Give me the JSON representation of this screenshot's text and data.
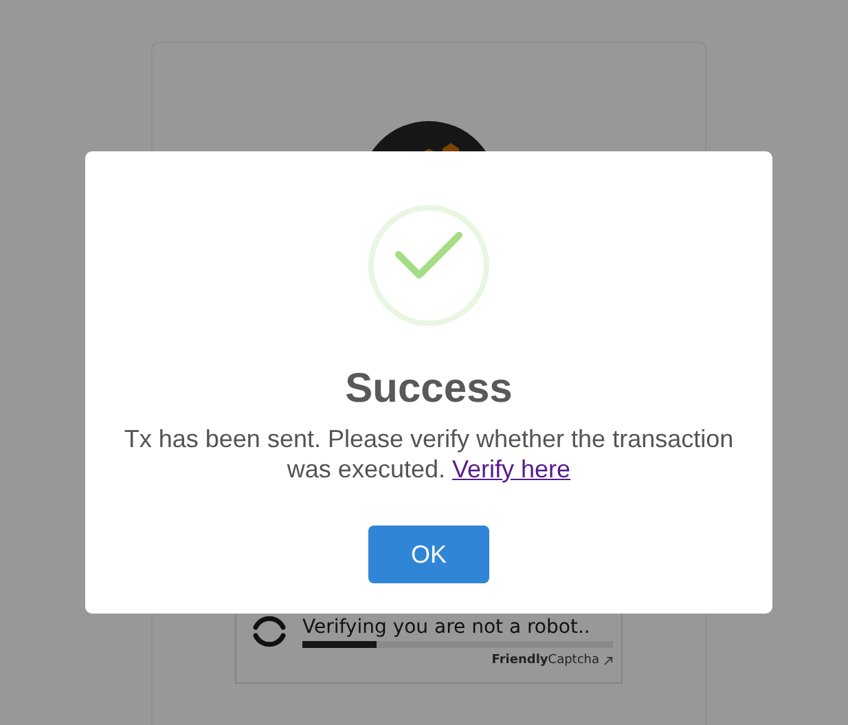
{
  "background": {
    "captcha": {
      "status": "Verifying you are not a robot..",
      "level": 0.24,
      "brand": "**Friendly**Captcha"
    }
  },
  "dialog": {
    "title": "Success",
    "message": "Tx has been sent. Please verify whether the transaction was executed.",
    "link": "Verify here",
    "button": "OK"
  }
}
